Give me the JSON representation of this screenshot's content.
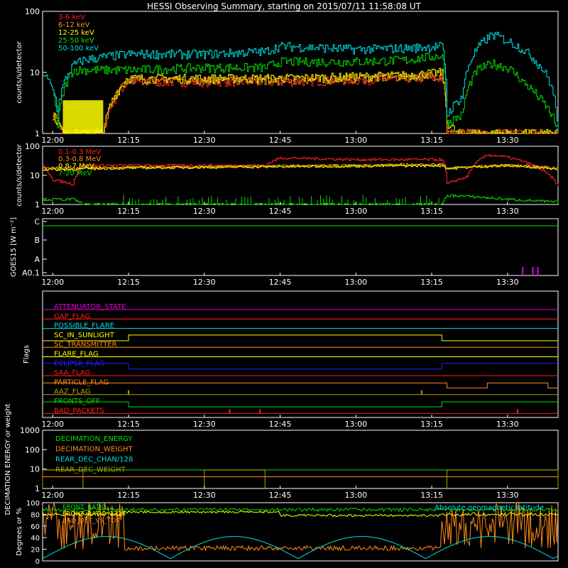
{
  "title": "HESSI Observing Summary, starting on 2015/07/11 11:58:08 UT",
  "time_ticks": [
    "12:00",
    "12:15",
    "12:30",
    "12:45",
    "13:00",
    "13:15",
    "13:30"
  ],
  "colors": {
    "bg": "#000000",
    "axis": "#ffffff",
    "red": "#ff2020",
    "orange": "#ff8c1a",
    "yellow": "#ffff00",
    "green": "#00e000",
    "cyan": "#00e0e0",
    "magenta": "#e000e0",
    "blue": "#2020ff",
    "olive": "#b0a000"
  },
  "chart_data": [
    {
      "type": "line",
      "panel": "counts-lo",
      "ylabel": "counts/s/detector",
      "yscale": "log",
      "ylim": [
        1,
        100
      ],
      "yticks": [
        "1",
        "10",
        "100"
      ],
      "x_range": [
        "11:58",
        "13:40"
      ],
      "series": [
        {
          "name": "3-6 keV",
          "color": "red",
          "x": [
            "12:00",
            "12:02",
            "12:04",
            "12:06",
            "12:10",
            "12:15",
            "12:30",
            "12:45",
            "13:00",
            "13:10",
            "13:17",
            "13:18",
            "13:20",
            "13:30",
            "13:40"
          ],
          "y": [
            2,
            1,
            1,
            1,
            1,
            7,
            7,
            7,
            7.5,
            8,
            8,
            1,
            1,
            1,
            1
          ]
        },
        {
          "name": "6-12 keV",
          "color": "orange",
          "x": [
            "12:00",
            "12:02",
            "12:04",
            "12:06",
            "12:10",
            "12:15",
            "12:30",
            "12:45",
            "13:00",
            "13:10",
            "13:17",
            "13:18",
            "13:20",
            "13:30",
            "13:40"
          ],
          "y": [
            2,
            1,
            1,
            1,
            1,
            7.5,
            7.5,
            7.5,
            8,
            8.5,
            9,
            1,
            1,
            1,
            1
          ]
        },
        {
          "name": "12-25 keV",
          "color": "yellow",
          "x": [
            "12:00",
            "12:02",
            "12:04",
            "12:06",
            "12:10",
            "12:15",
            "12:30",
            "12:45",
            "13:00",
            "13:10",
            "13:17",
            "13:18",
            "13:20",
            "13:30",
            "13:40"
          ],
          "y": [
            2,
            1,
            1,
            1,
            1,
            8,
            8,
            8,
            8.5,
            9,
            10,
            1.5,
            1,
            1,
            1
          ]
        },
        {
          "name": "25-50 keV",
          "color": "green",
          "x": [
            "12:00",
            "12:01",
            "12:04",
            "12:06",
            "12:10",
            "12:15",
            "12:30",
            "12:42",
            "12:45",
            "13:00",
            "13:10",
            "13:17",
            "13:18",
            "13:21",
            "13:24",
            "13:27",
            "13:30",
            "13:33",
            "13:36",
            "13:40"
          ],
          "y": [
            5,
            1.3,
            11,
            11,
            11,
            11,
            12,
            12,
            15,
            15,
            16,
            19,
            1.5,
            2,
            11,
            14,
            12,
            7,
            4,
            1
          ]
        },
        {
          "name": "50-100 keV",
          "color": "cyan",
          "x": [
            "11:58",
            "12:00",
            "12:01",
            "12:04",
            "12:06",
            "12:10",
            "12:15",
            "12:30",
            "12:42",
            "12:45",
            "13:00",
            "13:10",
            "13:17",
            "13:18",
            "13:21",
            "13:24",
            "13:27",
            "13:30",
            "13:33",
            "13:36",
            "13:38",
            "13:40"
          ],
          "y": [
            10,
            5,
            2.5,
            13,
            16,
            18,
            20,
            20,
            22,
            27,
            24,
            25,
            27,
            2,
            4,
            25,
            42,
            33,
            24,
            14,
            8,
            1
          ]
        }
      ]
    },
    {
      "type": "line",
      "panel": "counts-hi",
      "ylabel": "counts/s/detector",
      "yscale": "log",
      "ylim": [
        1,
        100
      ],
      "yticks": [
        "1",
        "10",
        "100"
      ],
      "x_range": [
        "11:58",
        "13:40"
      ],
      "series": [
        {
          "name": "0.1-0.3 MeV",
          "color": "red",
          "x": [
            "11:58",
            "12:00",
            "12:04",
            "12:06",
            "12:15",
            "12:30",
            "12:42",
            "12:45",
            "13:00",
            "13:17",
            "13:18",
            "13:22",
            "13:26",
            "13:29",
            "13:33",
            "13:37",
            "13:40"
          ],
          "y": [
            20,
            7,
            5,
            22,
            22,
            22,
            22,
            40,
            35,
            35,
            5,
            9,
            50,
            45,
            30,
            14,
            4
          ]
        },
        {
          "name": "0.3-0.8 MeV",
          "color": "orange",
          "x": [
            "11:58",
            "12:04",
            "12:06",
            "12:15",
            "12:30",
            "12:45",
            "13:00",
            "13:17",
            "13:18",
            "13:24",
            "13:30",
            "13:40"
          ],
          "y": [
            18,
            18,
            18,
            19,
            20,
            21,
            22,
            24,
            18,
            20,
            22,
            18
          ]
        },
        {
          "name": "0.8-7 MeV",
          "color": "yellow",
          "x": [
            "11:58",
            "12:04",
            "12:06",
            "12:15",
            "12:30",
            "12:45",
            "13:00",
            "13:17",
            "13:18",
            "13:24",
            "13:30",
            "13:40"
          ],
          "y": [
            16,
            16,
            17,
            18,
            19,
            20,
            21,
            22,
            17,
            20,
            22,
            17
          ]
        },
        {
          "name": "7-20 MeV",
          "color": "green",
          "x": [
            "11:58",
            "12:04",
            "12:06",
            "12:15",
            "12:30",
            "12:45",
            "13:00",
            "13:17",
            "13:18",
            "13:20",
            "13:30",
            "13:40"
          ],
          "y": [
            1.5,
            1.5,
            1,
            1,
            1,
            1,
            1,
            1,
            2,
            2,
            1.5,
            1.2
          ]
        }
      ]
    },
    {
      "type": "line",
      "panel": "goes",
      "ylabel": "GOES15 [W m⁻²]",
      "yticks": [
        "A0.1",
        "A",
        "B",
        "C"
      ],
      "series": [
        {
          "color": "green",
          "x": [
            "11:58",
            "13:40"
          ],
          "level": "C"
        },
        {
          "color": "magenta",
          "spikes": [
            "13:33",
            "13:35",
            "13:36"
          ]
        }
      ]
    },
    {
      "type": "line",
      "panel": "flags",
      "ylabel": "Flags",
      "flags": [
        {
          "name": "ATTENUATOR_STATE",
          "color": "magenta"
        },
        {
          "name": "GAP_FLAG",
          "color": "red"
        },
        {
          "name": "POSSIBLE_FLARE",
          "color": "cyan"
        },
        {
          "name": "SC_IN_SUNLIGHT",
          "color": "yellow"
        },
        {
          "name": "SC_TRANSMITTER",
          "color": "orange"
        },
        {
          "name": "FLARE_FLAG",
          "color": "yellow"
        },
        {
          "name": "ECLIPSE_FLAG",
          "color": "blue"
        },
        {
          "name": "SAA_FLAG",
          "color": "red"
        },
        {
          "name": "PARTICLE_FLAG",
          "color": "orange"
        },
        {
          "name": "AAZ_FLAG",
          "color": "olive"
        },
        {
          "name": "FRONTS_OFF",
          "color": "green"
        },
        {
          "name": "BAD_PACKETS",
          "color": "red"
        }
      ]
    },
    {
      "type": "line",
      "panel": "decimation",
      "ylabel": "DECIMATION ENERGY or weight",
      "yscale": "log",
      "ylim": [
        1,
        1000
      ],
      "yticks": [
        "1",
        "10",
        "100",
        "1000"
      ],
      "series": [
        {
          "name": "DECIMATION_ENERGY",
          "color": "green"
        },
        {
          "name": "DECIMATION_WEIGHT",
          "color": "orange"
        },
        {
          "name": "REAR_DEC_CHAN/128",
          "color": "cyan"
        },
        {
          "name": "REAR_DEC_WEIGHT",
          "color": "olive"
        }
      ]
    },
    {
      "type": "line",
      "panel": "ratios",
      "ylabel": "Degrees or %",
      "ylim": [
        0,
        100
      ],
      "yticks": [
        "0",
        "20",
        "40",
        "60",
        "80",
        "100"
      ],
      "annotation": "Absolute geomagnetic latitude",
      "series": [
        {
          "name": "FRONT_RATIO",
          "color": "green"
        },
        {
          "name": "FRONT_RATIO_1225",
          "color": "yellow"
        },
        {
          "name": "BAD_DET_VS_TOT",
          "color": "orange"
        }
      ]
    }
  ]
}
